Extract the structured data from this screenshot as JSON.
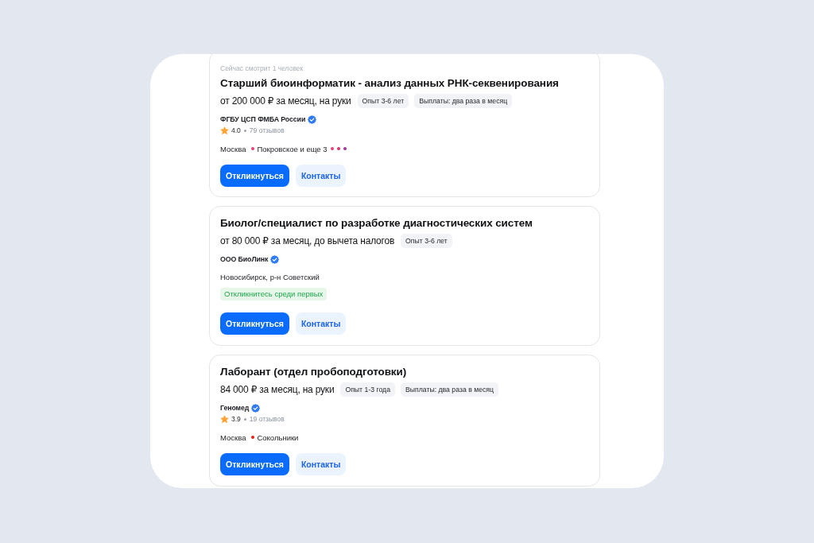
{
  "vacancies": [
    {
      "viewers": "Сейчас смотрит 1 человек",
      "title": "Старший биоинформатик - анализ данных РНК-секвенирования",
      "salary": "от 200 000 ₽ за месяц, на руки",
      "tags": [
        "Опыт 3-6 лет",
        "Выплаты: два раза в месяц"
      ],
      "company": {
        "name": "ФГБУ ЦСП ФМБА России",
        "verified": true
      },
      "rating": {
        "score": "4.0",
        "reviews": "79 отзывов"
      },
      "location": {
        "city": "Москва",
        "metro": {
          "color": "#e8407a",
          "name": "Покровское и еще 3",
          "other_lines": [
            {
              "color": "#e8407a"
            },
            {
              "color": "#d8336a"
            },
            {
              "color": "#a2359a"
            }
          ]
        }
      },
      "buttons": [
        {
          "kind": "primary",
          "label": "Откликнуться"
        },
        {
          "kind": "secondary",
          "label": "Контакты"
        }
      ]
    },
    {
      "title": "Биолог/специалист по разработке диагностических систем",
      "salary": "от 80 000 ₽ за месяц, до вычета налогов",
      "tags": [
        "Опыт 3-6 лет"
      ],
      "company": {
        "name": "ООО БиоЛинк",
        "verified": true
      },
      "location": {
        "city": "Новосибирск, р-н Советский"
      },
      "notice": "Откликнитесь среди первых",
      "buttons": [
        {
          "kind": "primary",
          "label": "Откликнуться"
        },
        {
          "kind": "secondary",
          "label": "Контакты"
        }
      ]
    },
    {
      "title": "Лаборант (отдел пробоподготовки)",
      "salary": "84 000 ₽ за месяц, на руки",
      "tags": [
        "Опыт 1-3 года",
        "Выплаты: два раза в месяц"
      ],
      "company": {
        "name": "Геномед",
        "verified": true
      },
      "rating": {
        "score": "3.9",
        "reviews": "19 отзывов"
      },
      "location": {
        "city": "Москва",
        "metro": {
          "color": "#e42313",
          "name": "Сокольники"
        }
      },
      "buttons": [
        {
          "kind": "primary",
          "label": "Откликнуться"
        },
        {
          "kind": "secondary",
          "label": "Контакты"
        }
      ]
    }
  ]
}
